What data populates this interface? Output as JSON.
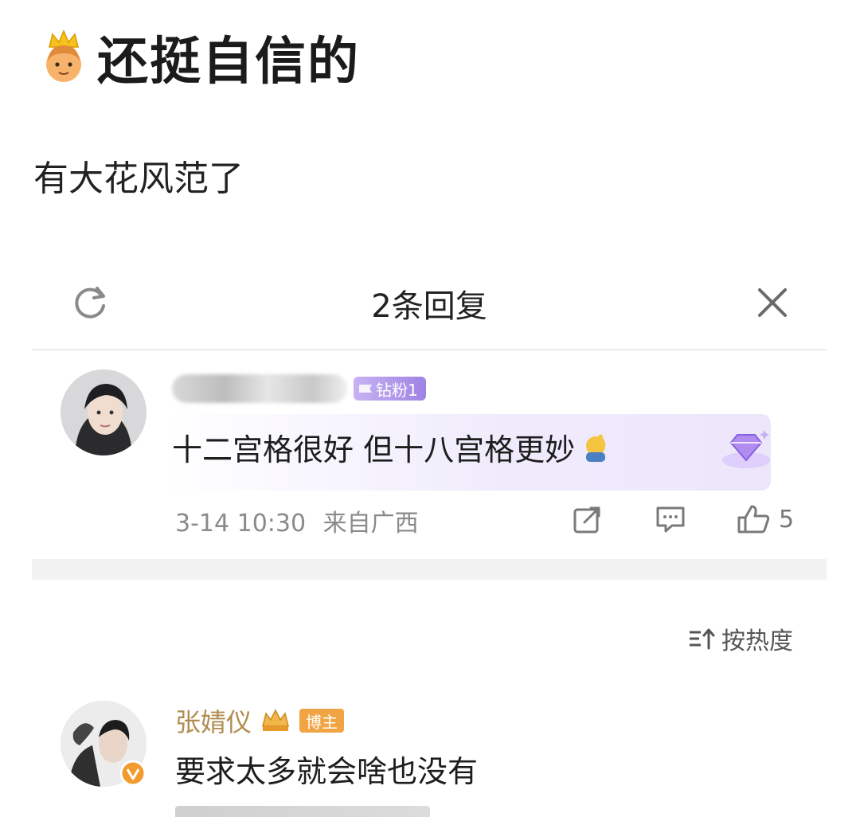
{
  "post": {
    "title": "还挺自信的",
    "body": "有大花风范了"
  },
  "sheet": {
    "title": "2条回复"
  },
  "reply": {
    "fan_badge": "钻粉1",
    "text": "十二宫格很好 但十八宫格更妙",
    "time": "3-14 10:30",
    "location": "来自广西",
    "like_count": "5"
  },
  "sort": {
    "label": "按热度"
  },
  "comment": {
    "user_name": "张婧仪",
    "badge": "博主",
    "text": "要求太多就会啥也没有"
  },
  "colors": {
    "fan_badge": "#b39df0",
    "blogger_badge": "#f1a443",
    "username_gold": "#b18b4f",
    "divider": "#f2f2f2"
  },
  "icons": [
    "crown-emoji-icon",
    "refresh-icon",
    "close-icon",
    "share-icon",
    "comment-icon",
    "like-icon",
    "sort-icon",
    "diamond-icon",
    "verified-icon"
  ]
}
